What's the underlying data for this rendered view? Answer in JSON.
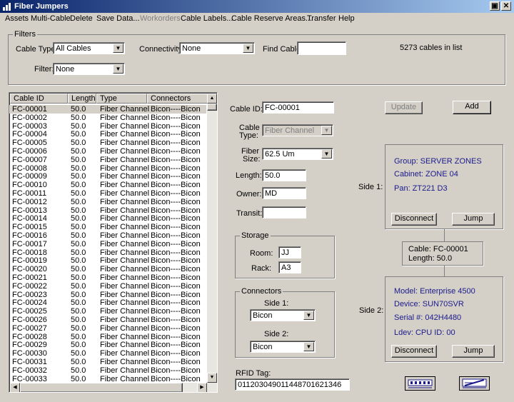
{
  "window": {
    "title": "Fiber Jumpers"
  },
  "menu": [
    "Assets",
    "Multi-Cable",
    "Delete",
    "Save Data...",
    "Workorders",
    "Cable Labels...",
    "Cable Reserve Areas...",
    "Transfer",
    "Help"
  ],
  "filters": {
    "group_title": "Filters",
    "cable_type_label": "Cable Type:",
    "cable_type_value": "All Cables",
    "connectivity_label": "Connectivity:",
    "connectivity_value": "None",
    "find_cable_label": "Find Cable:",
    "find_cable_value": "",
    "count_text": "5273 cables in list",
    "filter_label": "Filter:",
    "filter_value": "None"
  },
  "list": {
    "headers": [
      "Cable ID",
      "Length",
      "Type",
      "Connectors"
    ],
    "rows": [
      [
        "FC-00001",
        "50.0",
        "Fiber Channel",
        "Bicon----Bicon"
      ],
      [
        "FC-00002",
        "50.0",
        "Fiber Channel",
        "Bicon----Bicon"
      ],
      [
        "FC-00003",
        "50.0",
        "Fiber Channel",
        "Bicon----Bicon"
      ],
      [
        "FC-00004",
        "50.0",
        "Fiber Channel",
        "Bicon----Bicon"
      ],
      [
        "FC-00005",
        "50.0",
        "Fiber Channel",
        "Bicon----Bicon"
      ],
      [
        "FC-00006",
        "50.0",
        "Fiber Channel",
        "Bicon----Bicon"
      ],
      [
        "FC-00007",
        "50.0",
        "Fiber Channel",
        "Bicon----Bicon"
      ],
      [
        "FC-00008",
        "50.0",
        "Fiber Channel",
        "Bicon----Bicon"
      ],
      [
        "FC-00009",
        "50.0",
        "Fiber Channel",
        "Bicon----Bicon"
      ],
      [
        "FC-00010",
        "50.0",
        "Fiber Channel",
        "Bicon----Bicon"
      ],
      [
        "FC-00011",
        "50.0",
        "Fiber Channel",
        "Bicon----Bicon"
      ],
      [
        "FC-00012",
        "50.0",
        "Fiber Channel",
        "Bicon----Bicon"
      ],
      [
        "FC-00013",
        "50.0",
        "Fiber Channel",
        "Bicon----Bicon"
      ],
      [
        "FC-00014",
        "50.0",
        "Fiber Channel",
        "Bicon----Bicon"
      ],
      [
        "FC-00015",
        "50.0",
        "Fiber Channel",
        "Bicon----Bicon"
      ],
      [
        "FC-00016",
        "50.0",
        "Fiber Channel",
        "Bicon----Bicon"
      ],
      [
        "FC-00017",
        "50.0",
        "Fiber Channel",
        "Bicon----Bicon"
      ],
      [
        "FC-00018",
        "50.0",
        "Fiber Channel",
        "Bicon----Bicon"
      ],
      [
        "FC-00019",
        "50.0",
        "Fiber Channel",
        "Bicon----Bicon"
      ],
      [
        "FC-00020",
        "50.0",
        "Fiber Channel",
        "Bicon----Bicon"
      ],
      [
        "FC-00021",
        "50.0",
        "Fiber Channel",
        "Bicon----Bicon"
      ],
      [
        "FC-00022",
        "50.0",
        "Fiber Channel",
        "Bicon----Bicon"
      ],
      [
        "FC-00023",
        "50.0",
        "Fiber Channel",
        "Bicon----Bicon"
      ],
      [
        "FC-00024",
        "50.0",
        "Fiber Channel",
        "Bicon----Bicon"
      ],
      [
        "FC-00025",
        "50.0",
        "Fiber Channel",
        "Bicon----Bicon"
      ],
      [
        "FC-00026",
        "50.0",
        "Fiber Channel",
        "Bicon----Bicon"
      ],
      [
        "FC-00027",
        "50.0",
        "Fiber Channel",
        "Bicon----Bicon"
      ],
      [
        "FC-00028",
        "50.0",
        "Fiber Channel",
        "Bicon----Bicon"
      ],
      [
        "FC-00029",
        "50.0",
        "Fiber Channel",
        "Bicon----Bicon"
      ],
      [
        "FC-00030",
        "50.0",
        "Fiber Channel",
        "Bicon----Bicon"
      ],
      [
        "FC-00031",
        "50.0",
        "Fiber Channel",
        "Bicon----Bicon"
      ],
      [
        "FC-00032",
        "50.0",
        "Fiber Channel",
        "Bicon----Bicon"
      ],
      [
        "FC-00033",
        "50.0",
        "Fiber Channel",
        "Bicon----Bicon"
      ]
    ]
  },
  "detail": {
    "cable_id_label": "Cable ID:",
    "cable_id_value": "FC-00001",
    "cable_type_label_1": "Cable",
    "cable_type_label_2": "Type:",
    "cable_type_value": "Fiber Channel",
    "fiber_size_label_1": "Fiber",
    "fiber_size_label_2": "Size:",
    "fiber_size_value": "62.5 Um",
    "length_label": "Length:",
    "length_value": "50.0",
    "owner_label": "Owner:",
    "owner_value": "MD",
    "transit_label": "Transit:",
    "transit_value": "",
    "update_label": "Update",
    "add_label": "Add"
  },
  "storage": {
    "title": "Storage",
    "room_label": "Room:",
    "room_value": "JJ",
    "rack_label": "Rack:",
    "rack_value": "A3"
  },
  "connectors": {
    "title": "Connectors",
    "side1_label": "Side 1:",
    "side1_value": "Bicon",
    "side2_label": "Side 2:",
    "side2_value": "Bicon"
  },
  "rfid": {
    "label": "RFID Tag:",
    "value": "011203049011448701621346"
  },
  "side1": {
    "label": "Side 1:",
    "group": "Group:  SERVER ZONES",
    "cabinet": "Cabinet:  ZONE 04",
    "pan": "Pan: ZT221     D3",
    "disconnect": "Disconnect",
    "jump": "Jump"
  },
  "cable_box": {
    "cable": "Cable:  FC-00001",
    "length": "Length:  50.0"
  },
  "side2": {
    "label": "Side 2:",
    "model": "Model:  Enterprise 4500",
    "device": "Device:  SUN70SVR",
    "serial": "Serial #:  042H4480",
    "ldev": "Ldev:  CPU  ID:  00",
    "disconnect": "Disconnect",
    "jump": "Jump"
  },
  "colors": {
    "titlebar": "#0a246a",
    "link_text": "#1a1a8c",
    "face": "#d4d0c8"
  },
  "icons": [
    "app-icon",
    "minimize-restore-icon",
    "close-icon",
    "chevron-down-icon",
    "patch-panel-icon",
    "cable-jump-icon"
  ]
}
